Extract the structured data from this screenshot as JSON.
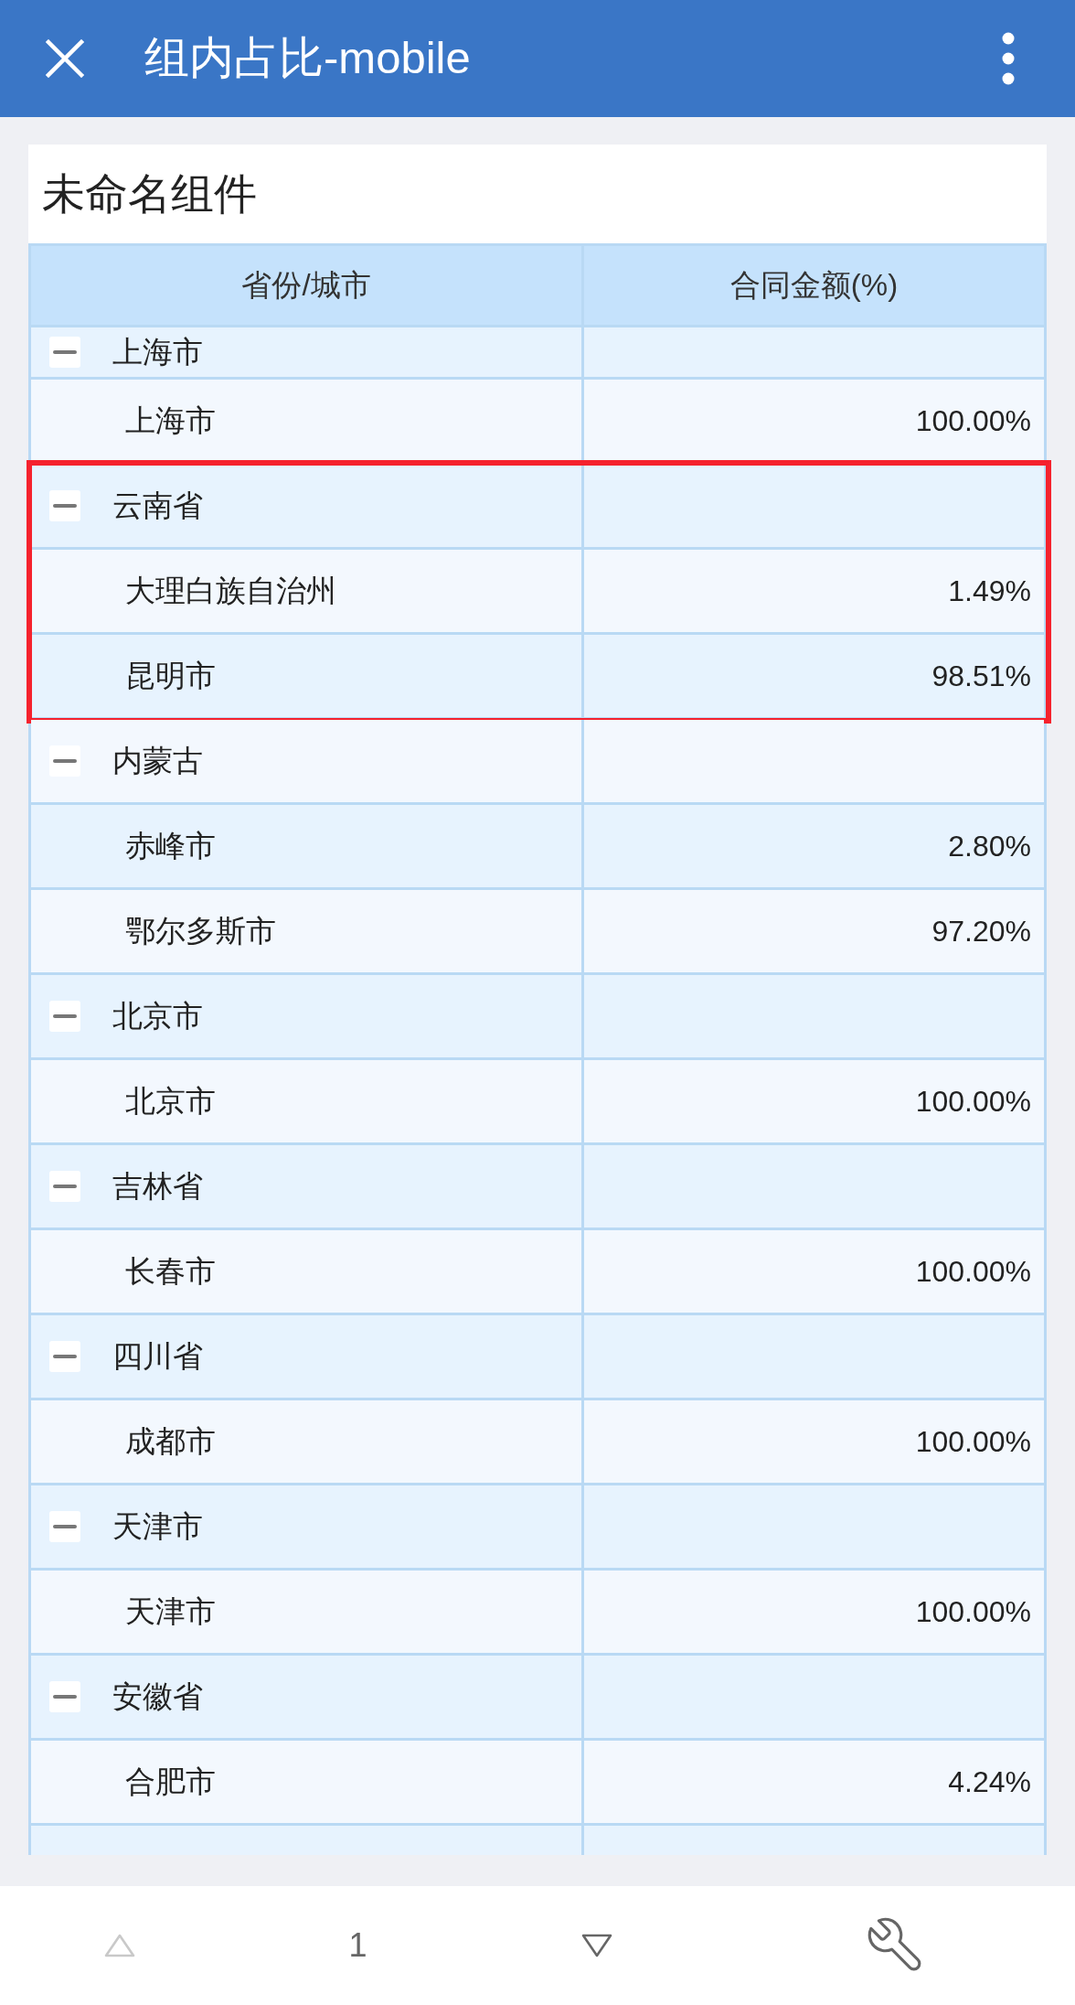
{
  "app_bar": {
    "title": "组内占比-mobile"
  },
  "widget": {
    "title": "未命名组件",
    "table": {
      "columns": [
        "省份/城市",
        "合同金额(%)"
      ],
      "rows": [
        {
          "name": "上海市",
          "expanded": true,
          "highlighted": false,
          "children": [
            {
              "name": "上海市",
              "value": "100.00%"
            }
          ]
        },
        {
          "name": "云南省",
          "expanded": true,
          "highlighted": true,
          "children": [
            {
              "name": "大理白族自治州",
              "value": "1.49%"
            },
            {
              "name": "昆明市",
              "value": "98.51%"
            }
          ]
        },
        {
          "name": "内蒙古",
          "expanded": true,
          "highlighted": false,
          "children": [
            {
              "name": "赤峰市",
              "value": "2.80%"
            },
            {
              "name": "鄂尔多斯市",
              "value": "97.20%"
            }
          ]
        },
        {
          "name": "北京市",
          "expanded": true,
          "highlighted": false,
          "children": [
            {
              "name": "北京市",
              "value": "100.00%"
            }
          ]
        },
        {
          "name": "吉林省",
          "expanded": true,
          "highlighted": false,
          "children": [
            {
              "name": "长春市",
              "value": "100.00%"
            }
          ]
        },
        {
          "name": "四川省",
          "expanded": true,
          "highlighted": false,
          "children": [
            {
              "name": "成都市",
              "value": "100.00%"
            }
          ]
        },
        {
          "name": "天津市",
          "expanded": true,
          "highlighted": false,
          "children": [
            {
              "name": "天津市",
              "value": "100.00%"
            }
          ]
        },
        {
          "name": "安徽省",
          "expanded": true,
          "highlighted": false,
          "children": [
            {
              "name": "合肥市",
              "value": "4.24%"
            }
          ]
        }
      ]
    }
  },
  "pager": {
    "previous": {
      "disabled": true
    },
    "page": "1",
    "next": {
      "disabled": false
    }
  }
}
